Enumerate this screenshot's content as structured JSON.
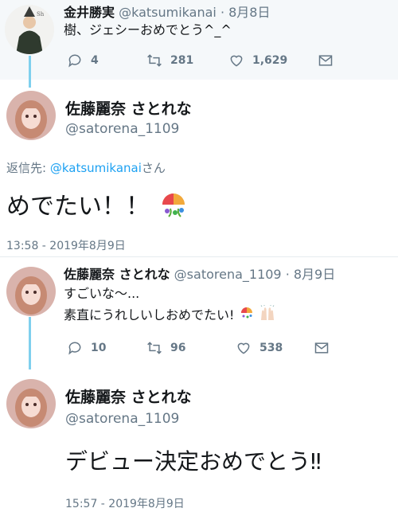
{
  "tweet1": {
    "name": "金井勝実",
    "handle": "@katsumikanai",
    "date": "· 8月8日",
    "text": "樹、ジェシーおめでとう^_^",
    "replies": "4",
    "retweets": "281",
    "likes": "1,629"
  },
  "tweet2": {
    "name": "佐藤麗奈 さとれな",
    "handle": "@satorena_1109",
    "reply_prefix": "返信先: ",
    "reply_to": "@katsumikanai",
    "reply_suffix": "さん",
    "text": "めでたい！！",
    "timestamp": "13:58 - 2019年8月9日"
  },
  "tweet3": {
    "name": "佐藤麗奈 さとれな",
    "handle": "@satorena_1109",
    "date": "· 8月9日",
    "line1": "すごいな〜...",
    "line2": "素直にうれしいしおめでたい!",
    "replies": "10",
    "retweets": "96",
    "likes": "538"
  },
  "tweet4": {
    "name": "佐藤麗奈 さとれな",
    "handle": "@satorena_1109",
    "text": "デビュー決定おめでとう‼",
    "timestamp": "15:57 - 2019年8月9日"
  },
  "colors": {
    "link": "#1da1f2",
    "muted": "#657786",
    "thread": "#7fd0ee"
  }
}
